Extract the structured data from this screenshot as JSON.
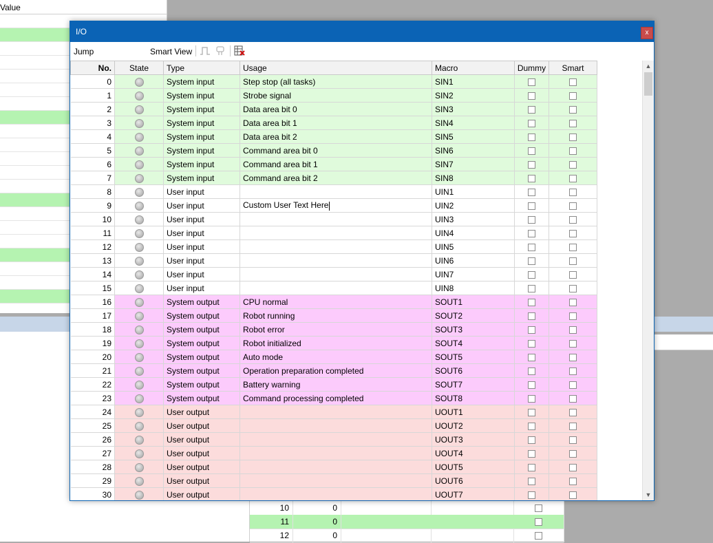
{
  "background": {
    "left_header": "Value",
    "left_rows_green": [
      1,
      7,
      13,
      17,
      20
    ],
    "grid_rows": [
      {
        "no": "10",
        "val": "0",
        "green": false
      },
      {
        "no": "11",
        "val": "0",
        "green": true
      },
      {
        "no": "12",
        "val": "0",
        "green": false
      }
    ]
  },
  "dialog": {
    "title": "I/O",
    "close_label": "x",
    "toolbar": {
      "jump": "Jump",
      "smart_view": "Smart View"
    },
    "columns": [
      "No.",
      "State",
      "Type",
      "Usage",
      "Macro",
      "Dummy",
      "Smart"
    ],
    "rows": [
      {
        "no": "0",
        "type": "System input",
        "usage": "Step stop (all tasks)",
        "macro": "SIN1",
        "group": "sin"
      },
      {
        "no": "1",
        "type": "System input",
        "usage": "Strobe signal",
        "macro": "SIN2",
        "group": "sin"
      },
      {
        "no": "2",
        "type": "System input",
        "usage": "Data area bit 0",
        "macro": "SIN3",
        "group": "sin"
      },
      {
        "no": "3",
        "type": "System input",
        "usage": "Data area bit 1",
        "macro": "SIN4",
        "group": "sin"
      },
      {
        "no": "4",
        "type": "System input",
        "usage": "Data area bit 2",
        "macro": "SIN5",
        "group": "sin"
      },
      {
        "no": "5",
        "type": "System input",
        "usage": "Command area  bit 0",
        "macro": "SIN6",
        "group": "sin"
      },
      {
        "no": "6",
        "type": "System input",
        "usage": "Command area  bit 1",
        "macro": "SIN7",
        "group": "sin"
      },
      {
        "no": "7",
        "type": "System input",
        "usage": "Command area  bit 2",
        "macro": "SIN8",
        "group": "sin"
      },
      {
        "no": "8",
        "type": "User input",
        "usage": "",
        "macro": "UIN1",
        "group": "uin"
      },
      {
        "no": "9",
        "type": "User input",
        "usage": "Custom User Text Here",
        "macro": "UIN2",
        "group": "uin",
        "editing": true
      },
      {
        "no": "10",
        "type": "User input",
        "usage": "",
        "macro": "UIN3",
        "group": "uin"
      },
      {
        "no": "11",
        "type": "User input",
        "usage": "",
        "macro": "UIN4",
        "group": "uin"
      },
      {
        "no": "12",
        "type": "User input",
        "usage": "",
        "macro": "UIN5",
        "group": "uin"
      },
      {
        "no": "13",
        "type": "User input",
        "usage": "",
        "macro": "UIN6",
        "group": "uin"
      },
      {
        "no": "14",
        "type": "User input",
        "usage": "",
        "macro": "UIN7",
        "group": "uin"
      },
      {
        "no": "15",
        "type": "User input",
        "usage": "",
        "macro": "UIN8",
        "group": "uin"
      },
      {
        "no": "16",
        "type": "System output",
        "usage": "CPU normal",
        "macro": "SOUT1",
        "group": "sout"
      },
      {
        "no": "17",
        "type": "System output",
        "usage": "Robot running",
        "macro": "SOUT2",
        "group": "sout"
      },
      {
        "no": "18",
        "type": "System output",
        "usage": "Robot error",
        "macro": "SOUT3",
        "group": "sout"
      },
      {
        "no": "19",
        "type": "System output",
        "usage": "Robot initialized",
        "macro": "SOUT4",
        "group": "sout"
      },
      {
        "no": "20",
        "type": "System output",
        "usage": "Auto mode",
        "macro": "SOUT5",
        "group": "sout"
      },
      {
        "no": "21",
        "type": "System output",
        "usage": "Operation preparation completed",
        "macro": "SOUT6",
        "group": "sout"
      },
      {
        "no": "22",
        "type": "System output",
        "usage": "Battery warning",
        "macro": "SOUT7",
        "group": "sout"
      },
      {
        "no": "23",
        "type": "System output",
        "usage": "Command processing completed",
        "macro": "SOUT8",
        "group": "sout"
      },
      {
        "no": "24",
        "type": "User output",
        "usage": "",
        "macro": "UOUT1",
        "group": "uout"
      },
      {
        "no": "25",
        "type": "User output",
        "usage": "",
        "macro": "UOUT2",
        "group": "uout"
      },
      {
        "no": "26",
        "type": "User output",
        "usage": "",
        "macro": "UOUT3",
        "group": "uout"
      },
      {
        "no": "27",
        "type": "User output",
        "usage": "",
        "macro": "UOUT4",
        "group": "uout"
      },
      {
        "no": "28",
        "type": "User output",
        "usage": "",
        "macro": "UOUT5",
        "group": "uout"
      },
      {
        "no": "29",
        "type": "User output",
        "usage": "",
        "macro": "UOUT6",
        "group": "uout"
      },
      {
        "no": "30",
        "type": "User output",
        "usage": "",
        "macro": "UOUT7",
        "group": "uout"
      }
    ]
  },
  "colors": {
    "title_bar": "#0b63b5",
    "system_input": "#e0fbdc",
    "system_output": "#fccbfc",
    "user_output": "#fcdcdc",
    "highlight_green": "#b5f3b1"
  }
}
